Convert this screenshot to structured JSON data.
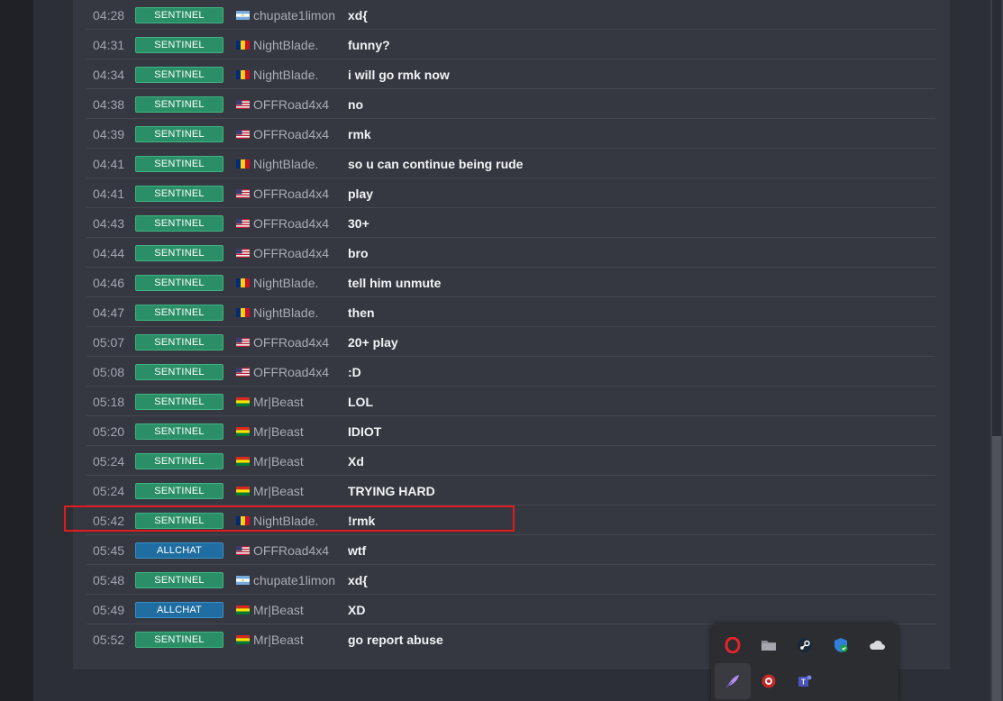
{
  "chat": {
    "rows": [
      {
        "time": "04:28",
        "channel": "SENTINEL",
        "flag": "argentina",
        "player": "chupate1limon",
        "message": "xd{"
      },
      {
        "time": "04:31",
        "channel": "SENTINEL",
        "flag": "romania",
        "player": "NightBlade.",
        "message": "funny?"
      },
      {
        "time": "04:34",
        "channel": "SENTINEL",
        "flag": "romania",
        "player": "NightBlade.",
        "message": "i will go rmk now"
      },
      {
        "time": "04:38",
        "channel": "SENTINEL",
        "flag": "usa",
        "player": "OFFRoad4x4",
        "message": "no"
      },
      {
        "time": "04:39",
        "channel": "SENTINEL",
        "flag": "usa",
        "player": "OFFRoad4x4",
        "message": "rmk"
      },
      {
        "time": "04:41",
        "channel": "SENTINEL",
        "flag": "romania",
        "player": "NightBlade.",
        "message": "so u can continue being rude"
      },
      {
        "time": "04:41",
        "channel": "SENTINEL",
        "flag": "usa",
        "player": "OFFRoad4x4",
        "message": "play"
      },
      {
        "time": "04:43",
        "channel": "SENTINEL",
        "flag": "usa",
        "player": "OFFRoad4x4",
        "message": "30+"
      },
      {
        "time": "04:44",
        "channel": "SENTINEL",
        "flag": "usa",
        "player": "OFFRoad4x4",
        "message": "bro"
      },
      {
        "time": "04:46",
        "channel": "SENTINEL",
        "flag": "romania",
        "player": "NightBlade.",
        "message": "tell him unmute"
      },
      {
        "time": "04:47",
        "channel": "SENTINEL",
        "flag": "romania",
        "player": "NightBlade.",
        "message": "then"
      },
      {
        "time": "05:07",
        "channel": "SENTINEL",
        "flag": "usa",
        "player": "OFFRoad4x4",
        "message": "20+ play"
      },
      {
        "time": "05:08",
        "channel": "SENTINEL",
        "flag": "usa",
        "player": "OFFRoad4x4",
        "message": ":D"
      },
      {
        "time": "05:18",
        "channel": "SENTINEL",
        "flag": "bolivia",
        "player": "Mr|Beast",
        "message": "LOL"
      },
      {
        "time": "05:20",
        "channel": "SENTINEL",
        "flag": "bolivia",
        "player": "Mr|Beast",
        "message": "IDIOT"
      },
      {
        "time": "05:24",
        "channel": "SENTINEL",
        "flag": "bolivia",
        "player": "Mr|Beast",
        "message": "Xd"
      },
      {
        "time": "05:24",
        "channel": "SENTINEL",
        "flag": "bolivia",
        "player": "Mr|Beast",
        "message": "TRYING HARD"
      },
      {
        "time": "05:42",
        "channel": "SENTINEL",
        "flag": "romania",
        "player": "NightBlade.",
        "message": "!rmk"
      },
      {
        "time": "05:45",
        "channel": "ALLCHAT",
        "flag": "usa",
        "player": "OFFRoad4x4",
        "message": "wtf"
      },
      {
        "time": "05:48",
        "channel": "SENTINEL",
        "flag": "argentina",
        "player": "chupate1limon",
        "message": "xd{"
      },
      {
        "time": "05:49",
        "channel": "ALLCHAT",
        "flag": "bolivia",
        "player": "Mr|Beast",
        "message": "XD"
      },
      {
        "time": "05:52",
        "channel": "SENTINEL",
        "flag": "bolivia",
        "player": "Mr|Beast",
        "message": "go report abuse"
      }
    ]
  },
  "tray": {
    "icons": [
      "opera-icon",
      "folder-icon",
      "steam-icon",
      "shield-check-icon",
      "onedrive-cloud-icon",
      "feather-icon",
      "red-circle-app-icon",
      "teams-icon"
    ]
  },
  "colors": {
    "sentinel": "#2a8f66",
    "allchat": "#1f6da1",
    "highlight": "#e11b1b"
  }
}
